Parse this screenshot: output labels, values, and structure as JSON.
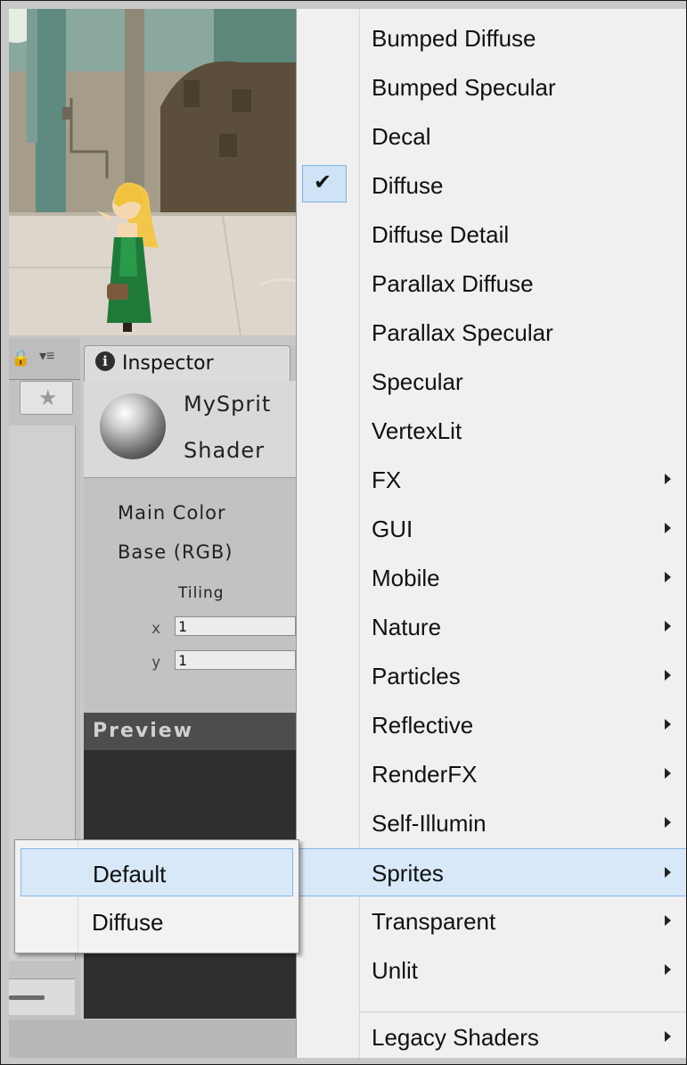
{
  "inspector": {
    "tab_label": "Inspector",
    "info_icon": "info-icon",
    "material_name": "MySprit",
    "shader_label": "Shader",
    "props": {
      "main_color": "Main Color",
      "base": "Base (RGB)",
      "tiling": "Tiling",
      "x_axis": "x",
      "y_axis": "y",
      "x_value": "1",
      "y_value": "1"
    },
    "preview_label": "Preview"
  },
  "left_panel": {
    "lock_icon": "lock-icon",
    "menu_icon": "panel-menu-icon",
    "star_icon": "star-icon"
  },
  "shader_menu": {
    "items": [
      {
        "label": "Bumped Diffuse",
        "submenu": false
      },
      {
        "label": "Bumped Specular",
        "submenu": false
      },
      {
        "label": "Decal",
        "submenu": false
      },
      {
        "label": "Diffuse",
        "submenu": false,
        "checked": true
      },
      {
        "label": "Diffuse Detail",
        "submenu": false
      },
      {
        "label": "Parallax Diffuse",
        "submenu": false
      },
      {
        "label": "Parallax Specular",
        "submenu": false
      },
      {
        "label": "Specular",
        "submenu": false
      },
      {
        "label": "VertexLit",
        "submenu": false
      },
      {
        "label": "FX",
        "submenu": true
      },
      {
        "label": "GUI",
        "submenu": true
      },
      {
        "label": "Mobile",
        "submenu": true
      },
      {
        "label": "Nature",
        "submenu": true
      },
      {
        "label": "Particles",
        "submenu": true
      },
      {
        "label": "Reflective",
        "submenu": true
      },
      {
        "label": "RenderFX",
        "submenu": true
      },
      {
        "label": "Self-Illumin",
        "submenu": true
      },
      {
        "label": "Sprites",
        "submenu": true,
        "highlighted": true
      },
      {
        "label": "Transparent",
        "submenu": true
      },
      {
        "label": "Unlit",
        "submenu": true
      },
      {
        "label": "Legacy Shaders",
        "submenu": true
      }
    ],
    "check_glyph": "✔"
  },
  "sprites_submenu": {
    "items": [
      {
        "label": "Default",
        "highlighted": true
      },
      {
        "label": "Diffuse"
      }
    ]
  },
  "colors": {
    "menu_bg": "#f0f0f0",
    "highlight": "#d8e8f8",
    "highlight_border": "#86b6e6",
    "panel_bg": "#c2c2c2",
    "preview_bg": "#2f2f2f"
  }
}
